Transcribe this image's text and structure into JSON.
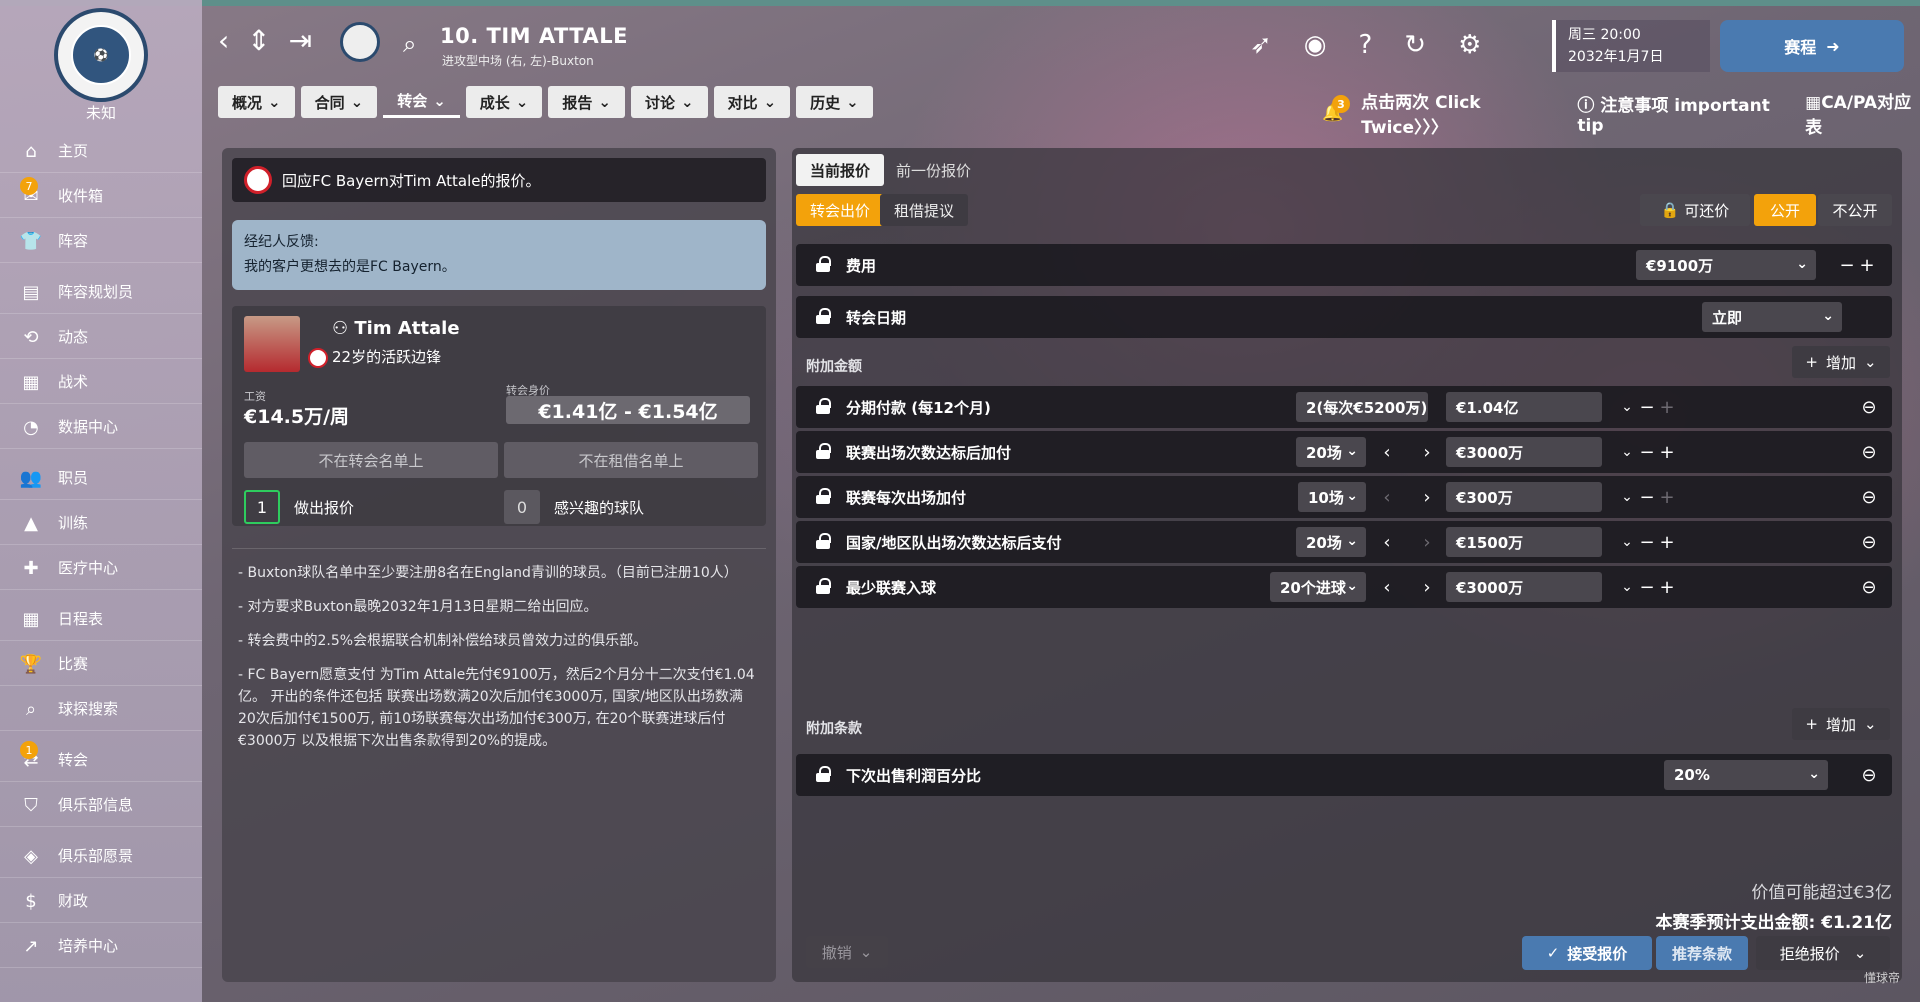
{
  "sidebar": {
    "club_name": "未知",
    "items": [
      {
        "label": "主页",
        "icon": "home-icon",
        "glyph": "⌂"
      },
      {
        "label": "收件箱",
        "icon": "inbox-icon",
        "glyph": "✉",
        "badge": "7"
      },
      {
        "label": "阵容",
        "icon": "shirt-icon",
        "glyph": "👕"
      },
      {
        "label": "阵容规划员",
        "icon": "clipboard-icon",
        "glyph": "▤"
      },
      {
        "label": "动态",
        "icon": "dynamics-icon",
        "glyph": "⟲"
      },
      {
        "label": "战术",
        "icon": "tactics-icon",
        "glyph": "▦"
      },
      {
        "label": "数据中心",
        "icon": "data-icon",
        "glyph": "◔"
      },
      {
        "label": "职员",
        "icon": "staff-icon",
        "glyph": "👥"
      },
      {
        "label": "训练",
        "icon": "training-icon",
        "glyph": "▲"
      },
      {
        "label": "医疗中心",
        "icon": "medical-icon",
        "glyph": "✚"
      },
      {
        "label": "日程表",
        "icon": "calendar-icon",
        "glyph": "▦"
      },
      {
        "label": "比赛",
        "icon": "trophy-icon",
        "glyph": "🏆"
      },
      {
        "label": "球探搜索",
        "icon": "scout-search-icon",
        "glyph": "⌕"
      },
      {
        "label": "转会",
        "icon": "transfer-icon",
        "glyph": "⇄",
        "badge": "1"
      },
      {
        "label": "俱乐部信息",
        "icon": "shield-icon",
        "glyph": "⛉"
      },
      {
        "label": "俱乐部愿景",
        "icon": "vision-icon",
        "glyph": "◈"
      },
      {
        "label": "财政",
        "icon": "finance-icon",
        "glyph": "$"
      },
      {
        "label": "培养中心",
        "icon": "development-icon",
        "glyph": "↗"
      }
    ]
  },
  "header": {
    "player_title": "10. TIM ATTALE",
    "player_sub": "进攻型中场 (右, 左)-Buxton",
    "date_line1": "周三 20:00",
    "date_line2": "2032年1月7日",
    "fixtures_label": "赛程",
    "tabs": [
      "概况",
      "合同",
      "转会",
      "成长",
      "报告",
      "讨论",
      "对比",
      "历史"
    ],
    "active_tab": "转会",
    "notif_count": "3",
    "tip1": "点击两次 Click Twice〉〉〉",
    "tip2": "注意事项 important tip",
    "tip3": "CA/PA对应表"
  },
  "left": {
    "bid_title": "回应FC Bayern对Tim Attale的报价。",
    "agent_title": "经纪人反馈:",
    "agent_text": "我的客户更想去的是FC Bayern。",
    "player_name": "Tim Attale",
    "player_desc": "22岁的活跃边锋",
    "wage_label": "工资",
    "wage": "€14.5万/周",
    "value_label": "转会身价",
    "value": "€1.41亿 - €1.54亿",
    "btn_transfer_list": "不在转会名单上",
    "btn_loan_list": "不在租借名单上",
    "offers_count": "1",
    "offers_label": "做出报价",
    "interested_count": "0",
    "interested_label": "感兴趣的球队",
    "notes": [
      "- Buxton球队名单中至少要注册8名在England青训的球员。（目前已注册10人）",
      "- 对方要求Buxton最晚2032年1月13日星期二给出回应。",
      "- 转会费中的2.5%会根据联合机制补偿给球员曾效力过的俱乐部。",
      "- FC Bayern愿意支付 为Tim Attale先付€9100万，然后2个月分十二次支付€1.04亿。 开出的条件还包括 联赛出场数满20次后加付€3000万, 国家/地区队出场数满20次后加付€1500万, 前10场联赛每次出场加付€300万, 在20个联赛进球后付€3000万 以及根据下次出售条款得到20%的提成。"
    ]
  },
  "right": {
    "tab_current": "当前报价",
    "tab_previous": "前一份报价",
    "tab_transfer": "转会出价",
    "tab_loan": "租借提议",
    "negotiable": "可还价",
    "public": "公开",
    "private": "不公开",
    "fee_label": "费用",
    "fee_value": "€9100万",
    "date_label": "转会日期",
    "date_value": "立即",
    "addons_label": "附加金额",
    "add_label": "增加",
    "rows": [
      {
        "label": "分期付款 (每12个月)",
        "opt": "2(每次€5200万)",
        "amount": "€1.04亿"
      },
      {
        "label": "联赛出场次数达标后加付",
        "opt": "20场",
        "amount": "€3000万"
      },
      {
        "label": "联赛每次出场加付",
        "opt": "10场",
        "amount": "€300万"
      },
      {
        "label": "国家/地区队出场次数达标后支付",
        "opt": "20场",
        "amount": "€1500万"
      },
      {
        "label": "最少联赛入球",
        "opt": "20个进球",
        "amount": "€3000万"
      }
    ],
    "clauses_label": "附加条款",
    "sellon_label": "下次出售利润百分比",
    "sellon_value": "20%",
    "value_note": "价值可能超过€3亿",
    "spend_note": "本赛季预计支出金额: €1.21亿",
    "cancel": "撤销",
    "accept": "接受报价",
    "suggest": "推荐条款",
    "reject": "拒绝报价"
  },
  "watermark": "懂球帝"
}
